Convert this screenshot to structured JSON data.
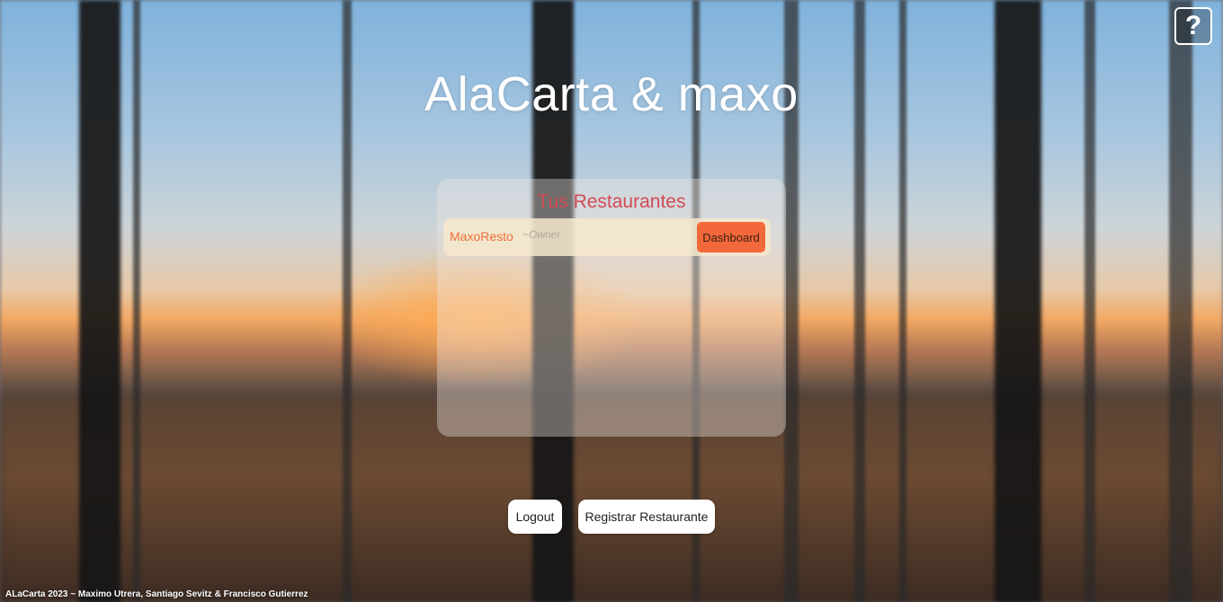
{
  "header": {
    "title": "AlaCarta & maxo",
    "help_label": "?"
  },
  "panel": {
    "title": "Tus Restaurantes",
    "restaurants": [
      {
        "name": "MaxoResto",
        "role": "~Owner",
        "action_label": "Dashboard"
      }
    ]
  },
  "actions": {
    "logout_label": "Logout",
    "register_label": "Registrar Restaurante"
  },
  "footer": {
    "text": "ALaCarta 2023 ~ Maximo Utrera, Santiago Sevitz & Francisco Gutierrez"
  },
  "colors": {
    "accent": "#f3683a",
    "panel_title": "#d24a55",
    "restaurant_name": "#ef6f38"
  },
  "icons": {
    "help": "question-mark-icon"
  }
}
